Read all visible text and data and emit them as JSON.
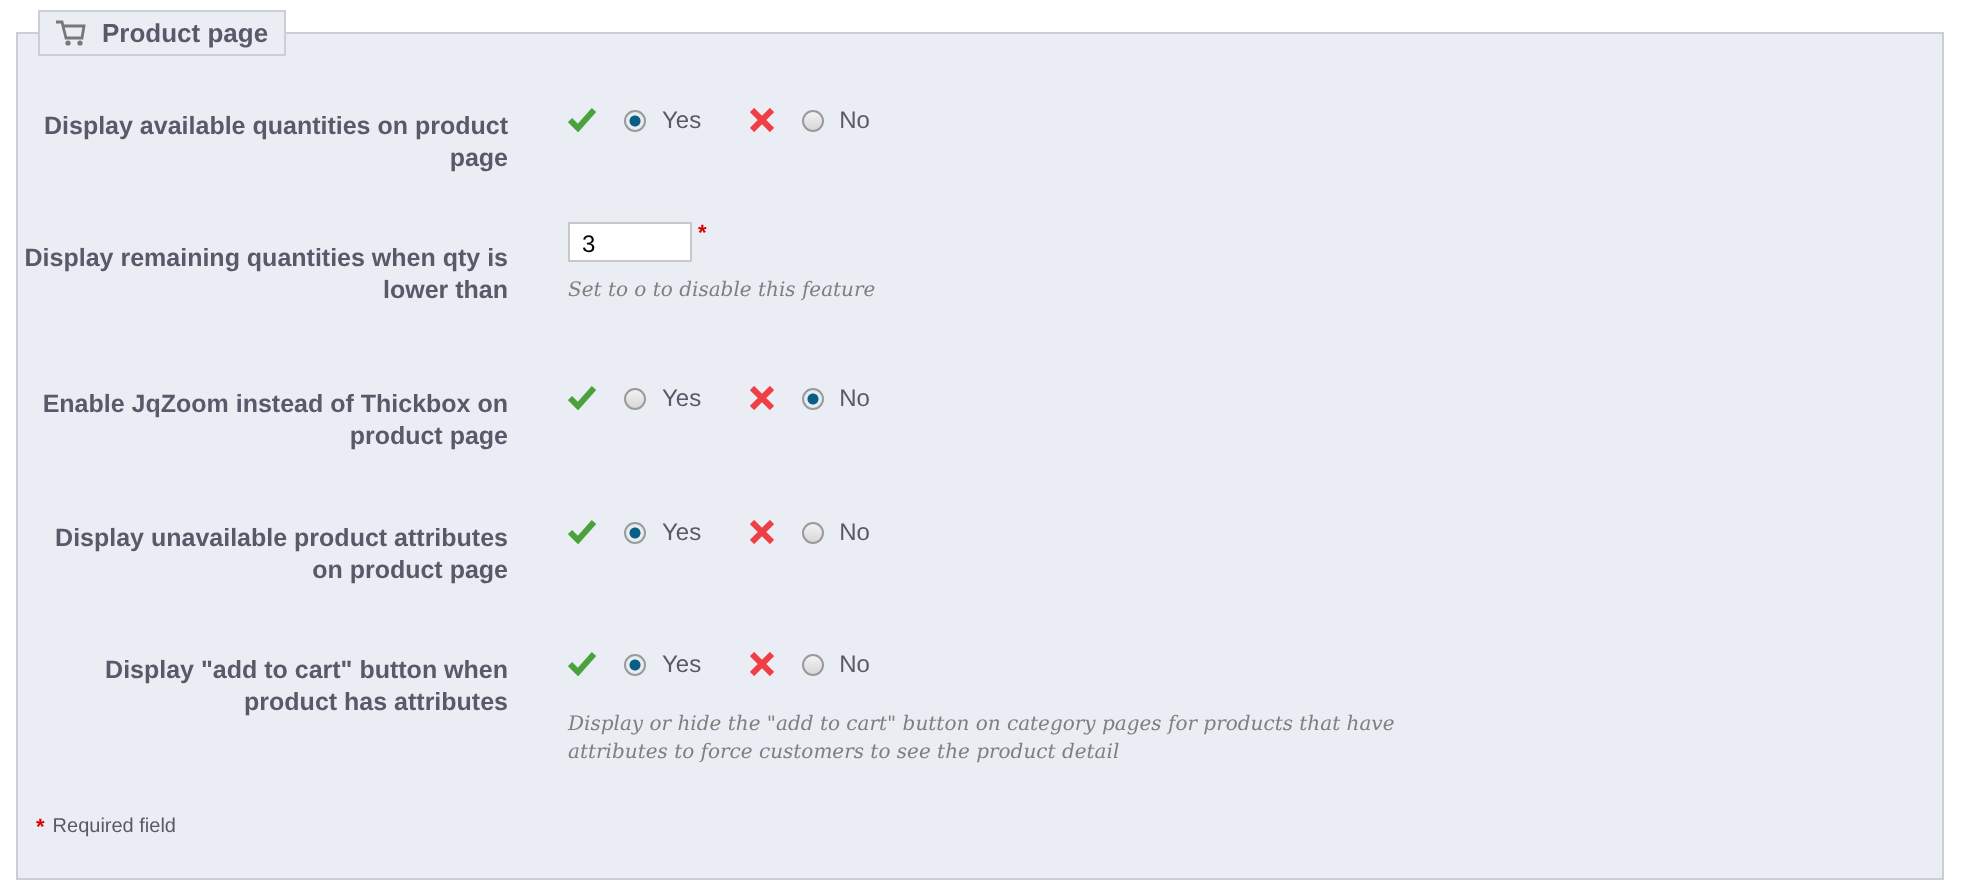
{
  "panel": {
    "title": "Product page"
  },
  "rows": [
    {
      "kind": "toggle",
      "label": "Display available quantities on product page",
      "options": [
        {
          "label": "Yes",
          "selected": true
        },
        {
          "label": "No",
          "selected": false
        }
      ]
    },
    {
      "kind": "text",
      "label": "Display remaining quantities when qty is lower than",
      "value": "3",
      "required_mark": "*",
      "hint": "Set to o to disable this feature"
    },
    {
      "kind": "toggle",
      "label": "Enable JqZoom instead of Thickbox on product page",
      "options": [
        {
          "label": "Yes",
          "selected": false
        },
        {
          "label": "No",
          "selected": true
        }
      ]
    },
    {
      "kind": "toggle",
      "label": "Display unavailable product attributes on product page",
      "options": [
        {
          "label": "Yes",
          "selected": true
        },
        {
          "label": "No",
          "selected": false
        }
      ]
    },
    {
      "kind": "toggle",
      "label": "Display \"add to cart\" button when product has attributes",
      "options": [
        {
          "label": "Yes",
          "selected": true
        },
        {
          "label": "No",
          "selected": false
        }
      ],
      "hint": "Display or hide the \"add to cart\" button on category pages for products that have attributes to force customers to see the product detail"
    }
  ],
  "required_note": {
    "mark": "*",
    "text": "Required field"
  }
}
